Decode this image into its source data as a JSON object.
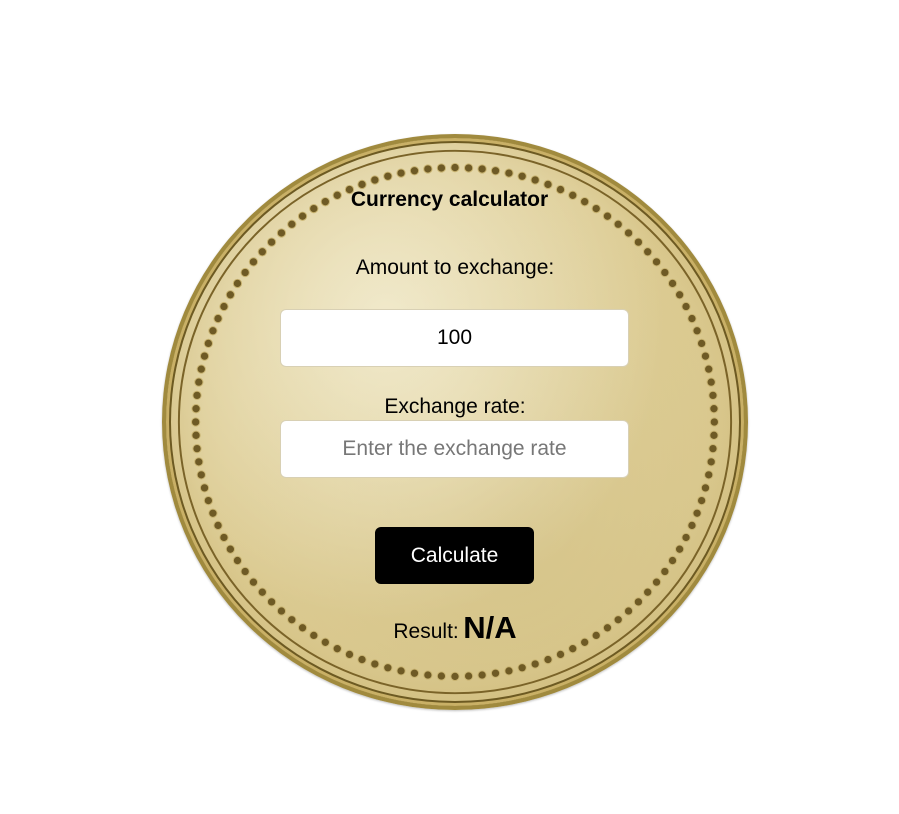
{
  "calculator": {
    "title": "Currency calculator",
    "amount_label": "Amount to exchange:",
    "amount_value": "100",
    "rate_label": "Exchange rate:",
    "rate_placeholder": "Enter the exchange rate",
    "rate_value": "",
    "calculate_label": "Calculate",
    "result_label": "Result:",
    "result_value": "N/A"
  },
  "colors": {
    "coin_gold": "#dccb92",
    "button_bg": "#000000",
    "button_text": "#ffffff"
  }
}
